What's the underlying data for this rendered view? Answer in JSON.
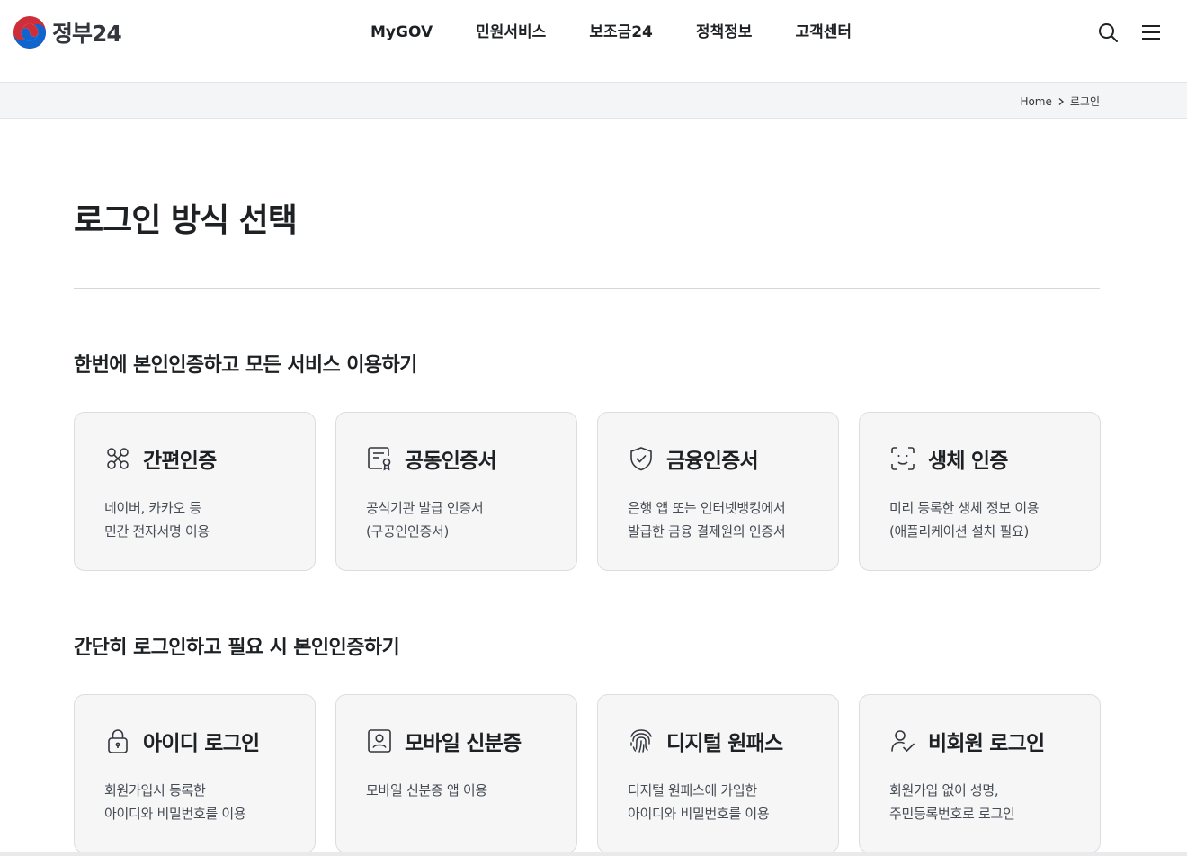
{
  "header": {
    "logo_text": "정부24",
    "nav": [
      "MyGOV",
      "민원서비스",
      "보조금24",
      "정책정보",
      "고객센터"
    ]
  },
  "breadcrumb": {
    "home": "Home",
    "current": "로그인"
  },
  "page": {
    "title": "로그인 방식 선택"
  },
  "sections": [
    {
      "title": "한번에 본인인증하고 모든 서비스 이용하기",
      "cards": [
        {
          "title": "간편인증",
          "icon": "link-nodes-icon",
          "desc": [
            "네이버, 카카오 등",
            "민간 전자서명 이용"
          ]
        },
        {
          "title": "공동인증서",
          "icon": "certificate-icon",
          "desc": [
            "공식기관 발급 인증서",
            "(구공인인증서)"
          ]
        },
        {
          "title": "금융인증서",
          "icon": "shield-check-icon",
          "desc": [
            "은행 앱 또는 인터넷뱅킹에서",
            "발급한 금융 결제원의 인증서"
          ]
        },
        {
          "title": "생체 인증",
          "icon": "face-scan-icon",
          "desc": [
            "미리 등록한 생체 정보 이용",
            "(애플리케이션 설치 필요)"
          ]
        }
      ]
    },
    {
      "title": "간단히 로그인하고 필요 시 본인인증하기",
      "cards": [
        {
          "title": "아이디 로그인",
          "icon": "lock-icon",
          "desc": [
            "회원가입시 등록한",
            "아이디와 비밀번호를 이용"
          ]
        },
        {
          "title": "모바일 신분증",
          "icon": "id-card-icon",
          "desc": [
            "모바일 신분증 앱 이용",
            ""
          ]
        },
        {
          "title": "디지털 원패스",
          "icon": "fingerprint-icon",
          "desc": [
            "디지털 원패스에 가입한",
            "아이디와 비밀번호를 이용"
          ]
        },
        {
          "title": "비회원 로그인",
          "icon": "user-check-icon",
          "desc": [
            "회원가입 없이 성명,",
            "주민등록번호로 로그인"
          ]
        }
      ]
    }
  ],
  "colors": {
    "brand_red": "#cd2e3a",
    "brand_blue": "#0f64cd",
    "card_bg": "#f6f6f7",
    "text_dark": "#1e2124"
  }
}
